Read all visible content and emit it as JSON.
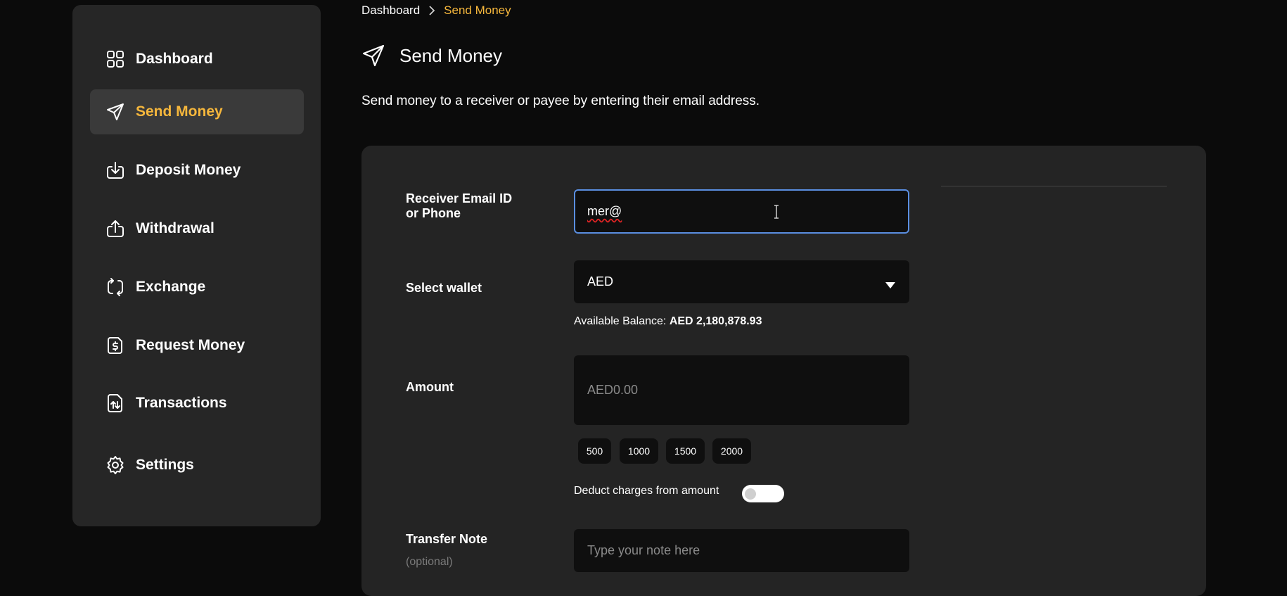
{
  "sidebar": {
    "items": [
      {
        "label": "Dashboard",
        "icon": "grid-icon",
        "active": false
      },
      {
        "label": "Send Money",
        "icon": "send-icon",
        "active": true
      },
      {
        "label": "Deposit Money",
        "icon": "download-icon",
        "active": false
      },
      {
        "label": "Withdrawal",
        "icon": "upload-icon",
        "active": false
      },
      {
        "label": "Exchange",
        "icon": "exchange-icon",
        "active": false
      },
      {
        "label": "Request Money",
        "icon": "request-money-icon",
        "active": false
      },
      {
        "label": "Transactions",
        "icon": "transactions-icon",
        "active": false
      },
      {
        "label": "Settings",
        "icon": "gear-icon",
        "active": false
      }
    ]
  },
  "breadcrumb": {
    "home": "Dashboard",
    "current": "Send Money"
  },
  "page": {
    "title": "Send Money",
    "description": "Send money to a receiver or payee by entering their email address."
  },
  "form": {
    "receiver": {
      "label_line1": "Receiver Email ID",
      "label_line2": "or Phone",
      "value": "mer@"
    },
    "wallet": {
      "label": "Select wallet",
      "selected": "AED"
    },
    "balance": {
      "prefix": "Available Balance:",
      "value": "AED 2,180,878.93"
    },
    "amount": {
      "label": "Amount",
      "placeholder": "AED0.00",
      "quick_amounts": [
        "500",
        "1000",
        "1500",
        "2000"
      ]
    },
    "deduct": {
      "label": "Deduct charges from amount",
      "enabled": false
    },
    "note": {
      "label": "Transfer Note",
      "sublabel": "(optional)",
      "placeholder": "Type your note here"
    }
  },
  "colors": {
    "accent": "#f6b73c",
    "focus": "#5a8ee0",
    "background": "#0b0b0b",
    "panel": "#262626"
  }
}
